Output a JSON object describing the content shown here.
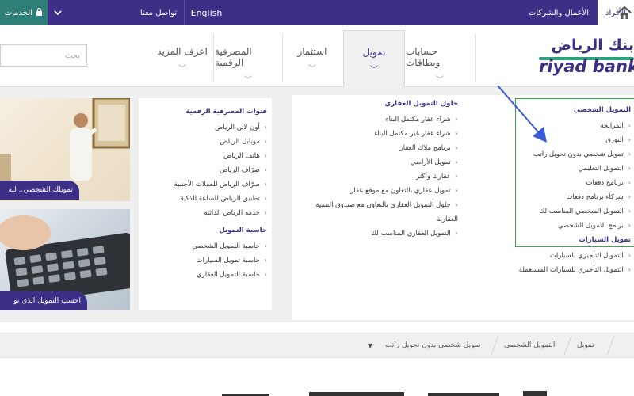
{
  "topbar": {
    "individuals": "الأفراد",
    "business": "الأعمال والشركات",
    "english": "English",
    "contact": "تواصل معنا",
    "services": "الخدمات"
  },
  "search": {
    "placeholder": "بحث"
  },
  "logo": {
    "arabic": "بنك الرياض",
    "english": "riyad bank"
  },
  "nav": {
    "accounts": "حسابات وبطاقات",
    "finance": "تمويل",
    "invest": "استثمار",
    "digital": "المصرفية الرقمية",
    "more": "اعرف المزيد"
  },
  "personal": {
    "title": "التمويل الشخصي",
    "items": [
      "المرابحة",
      "التورق",
      "تمويل شخصي بدون تحويل راتب",
      "التمويل التعليمي",
      "برنامج دفعات",
      "شركاء برنامج دفعات",
      "التمويل الشخصي المناسب لك",
      "برامج التمويل الشخصي"
    ]
  },
  "cars": {
    "title": "تمويل السيارات",
    "items": [
      "التمويل التأجيري للسيارات",
      "التمويل التأجيري للسيارات المستعملة"
    ]
  },
  "real_estate": {
    "title": "حلول التمويل العقاري",
    "items": [
      "شراء عقار مكتمل البناء",
      "شراء عقار غير مكتمل البناء",
      "برنامج ملاك العقار",
      "تمويل الأراضي",
      "عقارك وأكثر",
      "تمويل عقاري بالتعاون مع موقع عقار",
      "حلول التمويل العقاري بالتعاون مع صندوق التنمية العقارية",
      "التمويل العقاري المناسب لك"
    ]
  },
  "digital_channels": {
    "title": "قنوات المصرفية الرقمية",
    "items": [
      "أون لاين الرياض",
      "موبايل الرياض",
      "هاتف الرياض",
      "صرّاف الرياض",
      "صرّاف الرياض للعملات الأجنبية",
      "تطبيق الرياض للساعة الذكية",
      "خدمة الرياض الذاتية"
    ]
  },
  "calculators": {
    "title": "حاسبة التمويل",
    "items": [
      "حاسبة التمويل الشخصي",
      "حاسبة تمويل السيارات",
      "حاسبة التمويل العقاري"
    ]
  },
  "promos": {
    "personal": "تمويلك الشخصي.. ليه",
    "calc": "احسب التمويل الذي يو"
  },
  "breadcrumb": {
    "items": [
      "تمويل",
      "التمويل الشخصي",
      "تمويل شخصي بدون تحويل راتب"
    ]
  },
  "colors": {
    "brand": "#3d2e86",
    "teal": "#2f7f79",
    "annotation": "#39a84a",
    "arrow": "#3a5bd8"
  }
}
